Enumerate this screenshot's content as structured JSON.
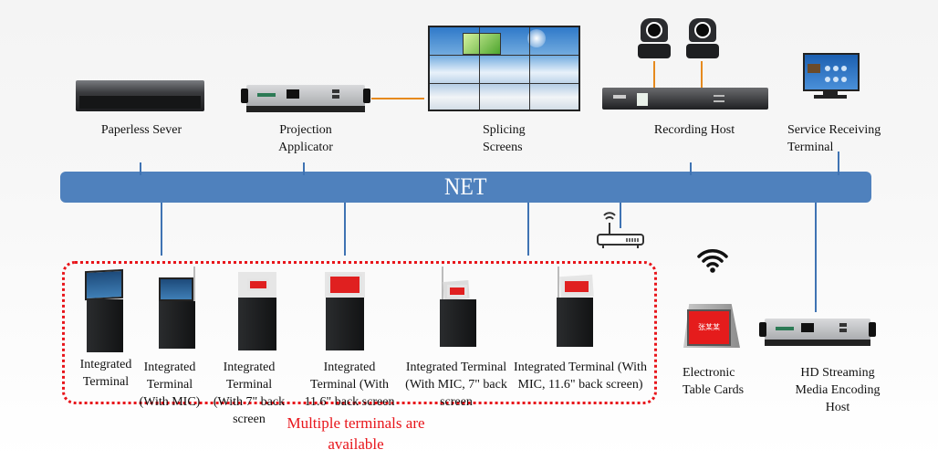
{
  "diagram": {
    "bus_label": "NET",
    "top_devices": [
      {
        "id": "paperless-server",
        "label": "Paperless Sever"
      },
      {
        "id": "projection-applicator",
        "label": "Projection\nApplicator"
      },
      {
        "id": "splicing-screens",
        "label": "Splicing\nScreens"
      },
      {
        "id": "recording-host",
        "label": "Recording Host"
      },
      {
        "id": "service-receiving-terminal",
        "label": "Service Receiving\nTerminal"
      }
    ],
    "terminals": [
      {
        "label": "Integrated\nTerminal",
        "screen": "blue",
        "mic": false
      },
      {
        "label": "Integrated\nTerminal\n(With MIC)",
        "screen": "blue",
        "mic": true
      },
      {
        "label": "Integrated\nTerminal\n(With 7\" back\nscreen",
        "screen": "red-small",
        "mic": false
      },
      {
        "label": "Integrated\nTerminal (With\n11.6\" back screen",
        "screen": "red-large",
        "mic": false
      },
      {
        "label": "Integrated Terminal\n(With MIC, 7\" back\nscreen",
        "screen": "red-small",
        "mic": true
      },
      {
        "label": "Integrated Terminal (With\nMIC, 11.6\" back screen)",
        "screen": "red-large",
        "mic": true
      }
    ],
    "terminals_note": "Multiple terminals are\navailable",
    "wireless_devices": [
      {
        "id": "electronic-table-cards",
        "label": "Electronic\nTable Cards",
        "card_text": "张某某"
      },
      {
        "id": "hd-streaming-host",
        "label": "HD Streaming\nMedia Encoding\nHost"
      }
    ],
    "colors": {
      "bus": "#4f81bd",
      "bus_connector": "#3f73b3",
      "video_link": "#e68a1e",
      "terminal_group_border": "#e8151b",
      "note_text": "#e8151b"
    }
  }
}
